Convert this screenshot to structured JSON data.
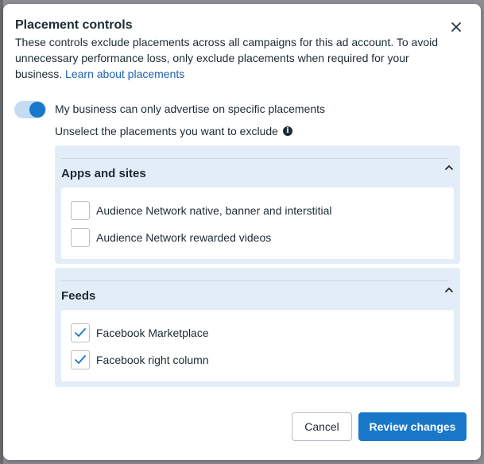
{
  "dialog": {
    "title": "Placement controls",
    "description": "These controls exclude placements across all campaigns for this ad account. To avoid unnecessary performance loss, only exclude placements when required for your business.",
    "learn_link": "Learn about placements",
    "close_icon": "close-icon"
  },
  "toggle": {
    "label": "My business can only advertise on specific placements",
    "on": true
  },
  "instruction": "Unselect the placements you want to exclude",
  "info_icon": "info-icon",
  "sections": [
    {
      "title": "Apps and sites",
      "expanded": true,
      "items": [
        {
          "label": "Audience Network native, banner and interstitial",
          "checked": false
        },
        {
          "label": "Audience Network rewarded videos",
          "checked": false
        }
      ]
    },
    {
      "title": "Feeds",
      "expanded": true,
      "items": [
        {
          "label": "Facebook Marketplace",
          "checked": true
        },
        {
          "label": "Facebook right column",
          "checked": true
        }
      ]
    }
  ],
  "buttons": {
    "cancel": "Cancel",
    "review": "Review changes"
  },
  "colors": {
    "accent": "#1877c8",
    "link": "#1f62b0",
    "section_bg": "#e3edf7"
  }
}
